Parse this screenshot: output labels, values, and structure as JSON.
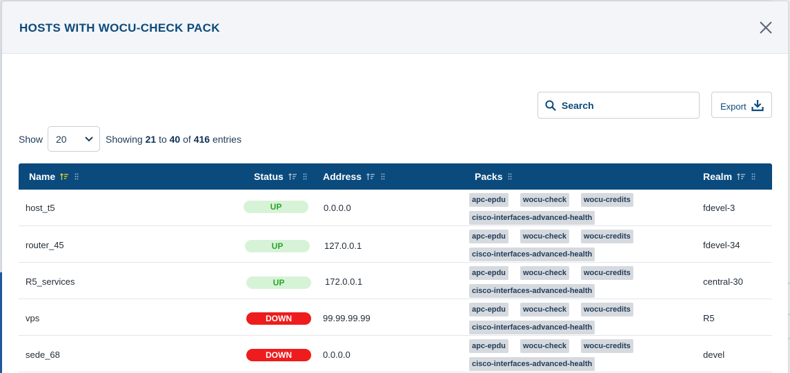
{
  "modal": {
    "title": "HOSTS WITH WOCU-CHECK PACK",
    "close_icon": "close-icon"
  },
  "toolbar": {
    "search_placeholder": "Search",
    "export_label": "Export"
  },
  "pagination": {
    "show_label": "Show",
    "page_size": "20",
    "showing_prefix": "Showing",
    "from": "21",
    "to_word": "to",
    "to": "40",
    "of_word": "of",
    "total": "416",
    "entries_word": "entries"
  },
  "table": {
    "columns": [
      {
        "label": "Name",
        "sort_active": true
      },
      {
        "label": "Status",
        "sort_active": false
      },
      {
        "label": "Address",
        "sort_active": false
      },
      {
        "label": "Packs",
        "sortable": false
      },
      {
        "label": "Realm",
        "sort_active": false
      }
    ],
    "rows": [
      {
        "name": "host_t5",
        "status": "UP",
        "address": "0.0.0.0",
        "packs": [
          "apc-epdu",
          "wocu-check",
          "wocu-credits",
          "cisco-interfaces-advanced-health"
        ],
        "realm": "fdevel-3"
      },
      {
        "name": "router_45",
        "status": "UP",
        "address": "127.0.0.1",
        "packs": [
          "apc-epdu",
          "wocu-check",
          "wocu-credits",
          "cisco-interfaces-advanced-health"
        ],
        "realm": "fdevel-34"
      },
      {
        "name": "R5_services",
        "status": "UP",
        "address": "172.0.0.1",
        "packs": [
          "apc-epdu",
          "wocu-check",
          "wocu-credits",
          "cisco-interfaces-advanced-health"
        ],
        "realm": "central-30"
      },
      {
        "name": "vps",
        "status": "DOWN",
        "address": "99.99.99.99",
        "packs": [
          "apc-epdu",
          "wocu-check",
          "wocu-credits",
          "cisco-interfaces-advanced-health"
        ],
        "realm": "R5"
      },
      {
        "name": "sede_68",
        "status": "DOWN",
        "address": "0.0.0.0",
        "packs": [
          "apc-epdu",
          "wocu-check",
          "wocu-credits",
          "cisco-interfaces-advanced-health"
        ],
        "realm": "devel"
      }
    ]
  },
  "colors": {
    "header_blue": "#0b4a7d",
    "title_blue": "#0d4a7c",
    "sort_active": "#f2d024",
    "up_bg": "#d7f3d7",
    "up_text": "#2aa52a",
    "down_bg": "#ee1c1c"
  }
}
